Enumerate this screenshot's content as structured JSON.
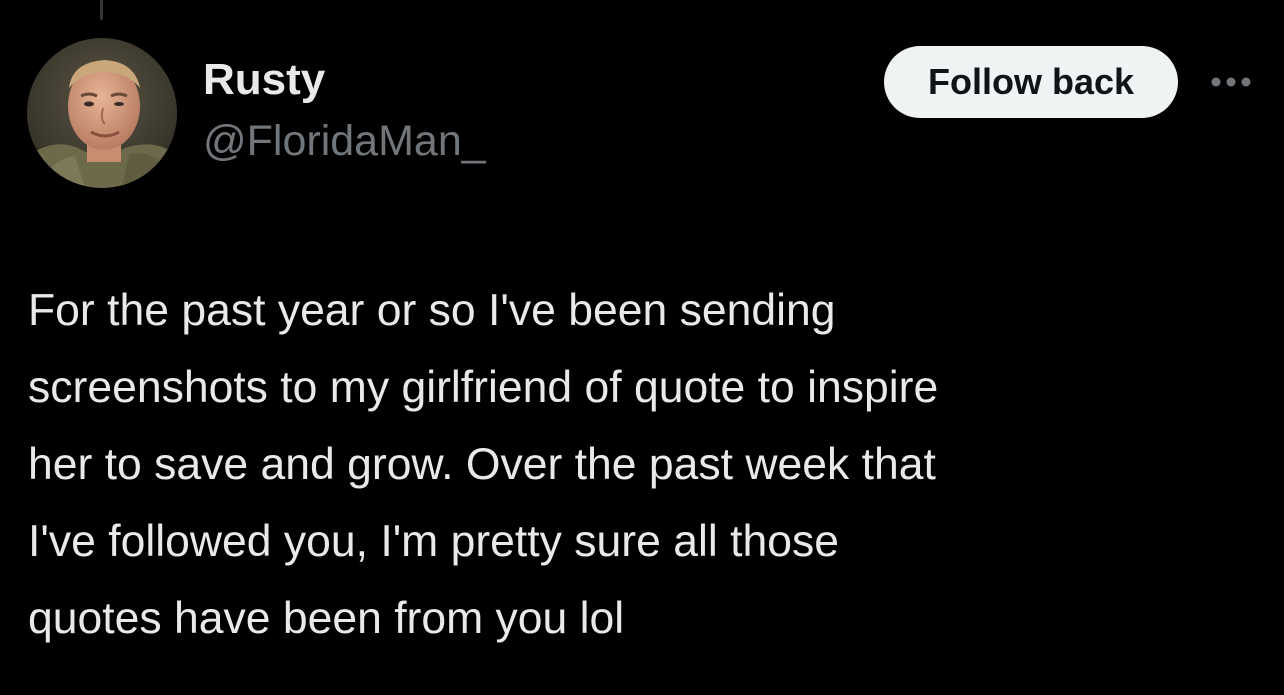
{
  "author": {
    "display_name": "Rusty",
    "handle": "@FloridaMan_",
    "avatar_icon": "user-avatar-photo"
  },
  "actions": {
    "follow_label": "Follow back",
    "more_icon": "more-horizontal-icon"
  },
  "tweet": {
    "lines": [
      "For the past year or so I've been sending",
      "screenshots to my girlfriend of quote to inspire",
      "her to save and grow. Over the past week that",
      "I've followed you, I'm pretty sure all those",
      "quotes have been from you lol"
    ]
  },
  "colors": {
    "background": "#000000",
    "primary_text": "#e7e9ea",
    "secondary_text": "#71767b",
    "button_bg": "#eff3f4",
    "button_text": "#0f1419"
  }
}
